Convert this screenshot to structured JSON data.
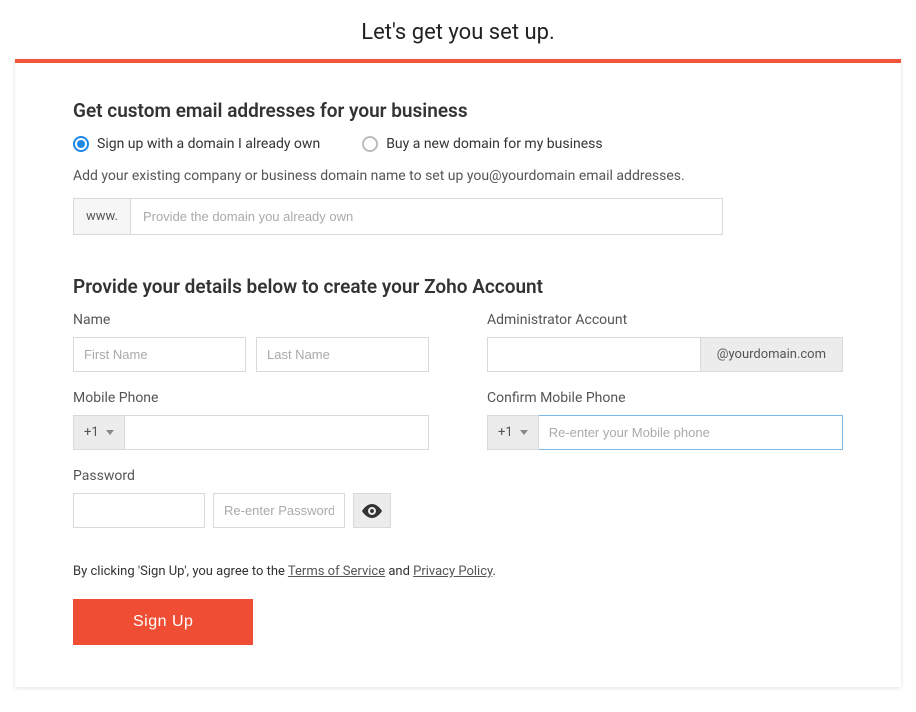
{
  "page_title": "Let's get you set up.",
  "domain_section": {
    "heading": "Get custom email addresses for your business",
    "option_own": "Sign up with a domain I already own",
    "option_buy": "Buy a new domain for my business",
    "helper": "Add your existing company or business domain name to set up you@yourdomain email addresses.",
    "prefix": "www.",
    "placeholder": "Provide the domain you already own"
  },
  "details_section": {
    "heading": "Provide your details below to create your Zoho Account",
    "name_label": "Name",
    "first_name_placeholder": "First Name",
    "last_name_placeholder": "Last Name",
    "admin_label": "Administrator Account",
    "admin_suffix": "@yourdomain.com",
    "mobile_label": "Mobile Phone",
    "confirm_mobile_label": "Confirm Mobile Phone",
    "country_code": "+1",
    "confirm_mobile_placeholder": "Re-enter your Mobile phone",
    "password_label": "Password",
    "reenter_password_placeholder": "Re-enter Password"
  },
  "footer": {
    "agree_prefix": "By clicking 'Sign Up', you agree to the ",
    "tos": "Terms of Service",
    "and": " and ",
    "privacy": "Privacy Policy",
    "period": ".",
    "signup": "Sign Up"
  }
}
